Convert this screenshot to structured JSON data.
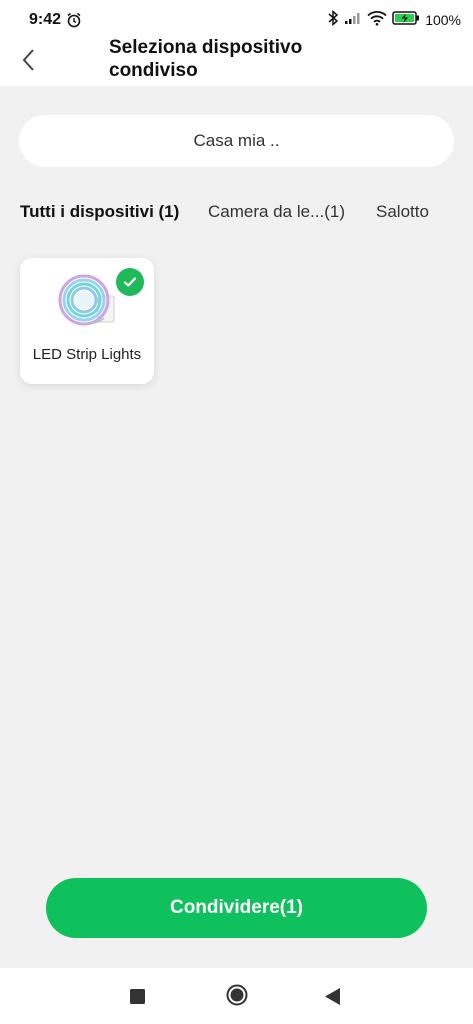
{
  "status_bar": {
    "time": "9:42",
    "battery": "100%",
    "icons": [
      "alarm-icon",
      "bluetooth-icon",
      "signal-icon",
      "wifi-icon",
      "battery-charging-icon"
    ]
  },
  "header": {
    "back_icon": "chevron-left-icon",
    "title": "Seleziona dispositivo condiviso"
  },
  "home_selector": {
    "label": "Casa mia .."
  },
  "tabs": [
    {
      "label": "Tutti i dispositivi (1)",
      "active": true
    },
    {
      "label": "Camera da le...(1)",
      "active": false
    },
    {
      "label": "Salotto",
      "active": false
    }
  ],
  "devices": [
    {
      "name": "LED Strip Lights",
      "selected": true,
      "icon": "led-strip-icon"
    }
  ],
  "share_button": {
    "label": "Condividere(1)"
  },
  "nav_bar": {
    "buttons": [
      "recents-square-icon",
      "home-circle-icon",
      "back-triangle-icon"
    ]
  },
  "colors": {
    "accent": "#0fc15c",
    "check": "#1fb85a",
    "background": "#f1f1f1"
  }
}
